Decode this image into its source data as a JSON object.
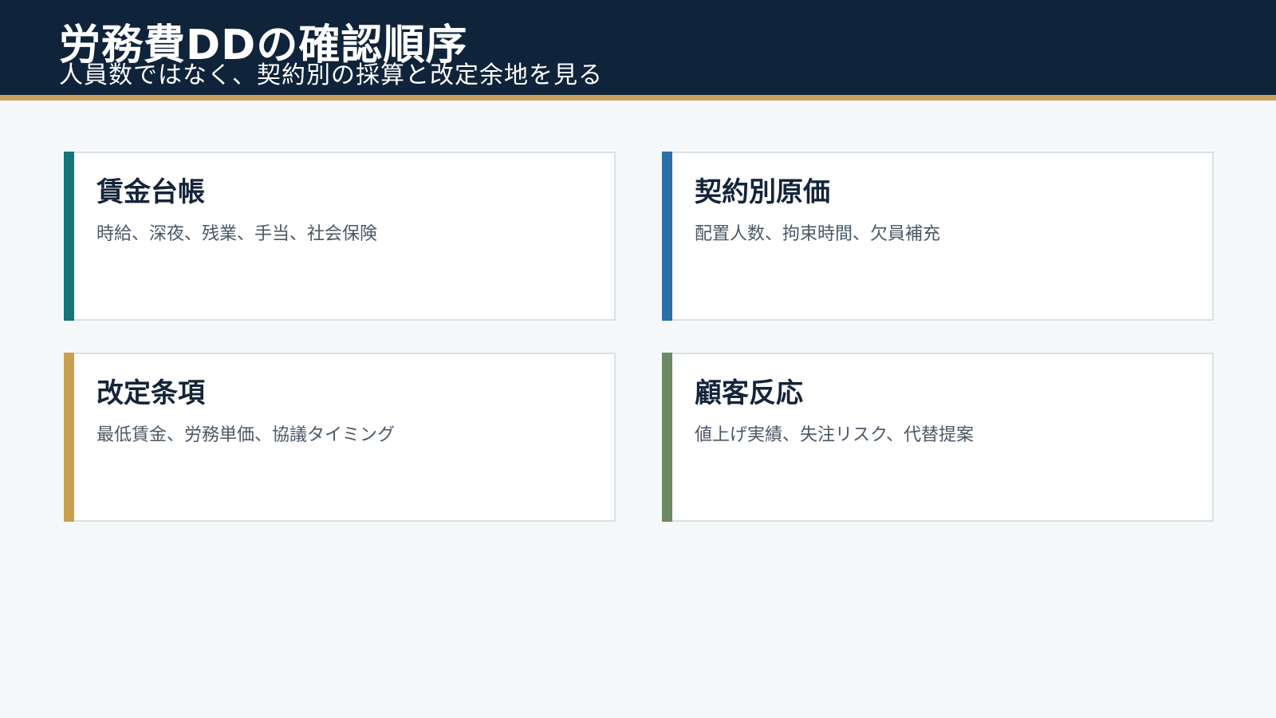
{
  "header": {
    "title": "労務費DDの確認順序",
    "subtitle": "人員数ではなく、契約別の採算と改定余地を見る",
    "background_color": "#0f233a",
    "accent_color": "#c9a35a"
  },
  "cards": [
    {
      "title": "賃金台帳",
      "description": "時給、深夜、残業、手当、社会保険",
      "accent_color": "#137577"
    },
    {
      "title": "契約別原価",
      "description": "配置人数、拘束時間、欠員補充",
      "accent_color": "#2a6fa8"
    },
    {
      "title": "改定条項",
      "description": "最低賃金、労務単価、協議タイミング",
      "accent_color": "#c9a050"
    },
    {
      "title": "顧客反応",
      "description": "値上げ実績、失注リスク、代替提案",
      "accent_color": "#6b8963"
    }
  ]
}
